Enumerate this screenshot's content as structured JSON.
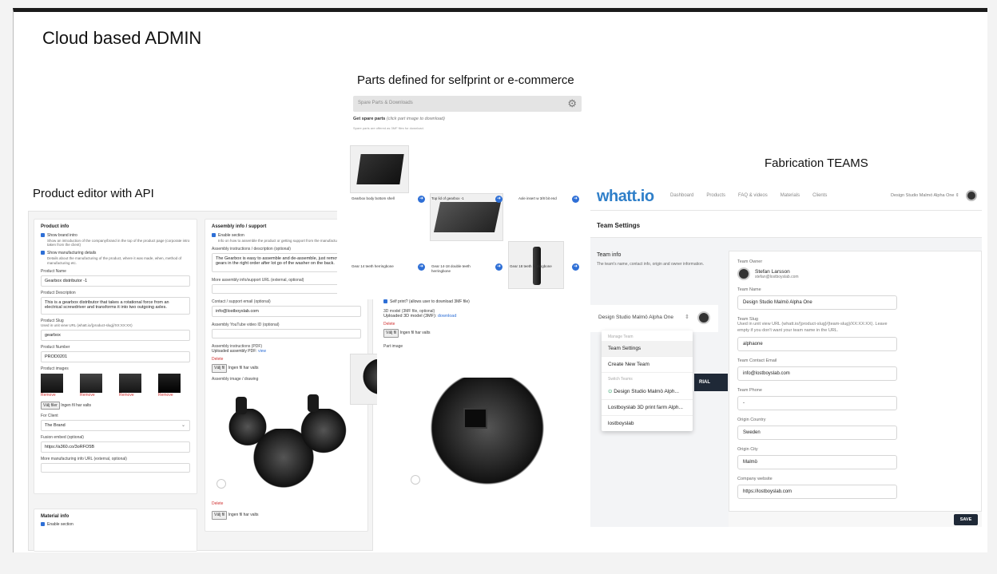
{
  "headings": {
    "cloud": "Cloud based ADMIN",
    "parts": "Parts defined for selfprint or e-commerce",
    "teams": "Fabrication TEAMS",
    "product": "Product editor with API"
  },
  "product_editor": {
    "section_title": "Product info",
    "show_brand": "Show brand intro",
    "show_brand_desc": "Show an introduction of the company/brand in the top of the product page (corporate intro taken from the client)",
    "show_mfg": "Show manufacturing details",
    "show_mfg_desc": "Details about the manufacturing of the product, where it was made, when, method of manufacturing etc.",
    "name_label": "Product Name",
    "name_value": "Gearbox distributor -1",
    "desc_label": "Product Description",
    "desc_value": "This is a gearbox distributor that takes a rotational force from an electrical screwdriver and transforms it into two outgoing axles.",
    "slug_label": "Product Slug",
    "slug_hint": "Used in unit view URL (whatt.io/{product-slug}/XX:XX:XX)",
    "slug_value": "gearbox",
    "number_label": "Product Number",
    "number_value": "PROD0201",
    "images_label": "Product images",
    "remove": "Remove",
    "choose_files": "Välj filer",
    "no_file": "Ingen fil har valts",
    "client_label": "For Client",
    "client_value": "The Brand",
    "fusion_label": "Fusion embed (optional)",
    "fusion_value": "https://a360.co/3oRFO5B",
    "more_url_label": "More manufacturing info URL (external, optional)",
    "material_title": "Material info",
    "enable_section": "Enable section"
  },
  "assembly": {
    "title": "Assembly info / support",
    "enable": "Enable section",
    "enable_desc": "Info on how to assemble the product or getting support from the manufacturer",
    "instr_label": "Assembly instructions / description (optional)",
    "instr_value": "The Gearbox is easy to assemble and de-assemble, just remove the gears in the right order after lot go of the washer on the back.",
    "url_label": "More assembly info/support URL (external, optional)",
    "email_label": "Contact / support email (optional)",
    "email_value": "info@lostboyslab.com",
    "yt_label": "Assembly YouTube video ID (optional)",
    "pdf_label": "Assembly instructions (PDF)",
    "pdf_uploaded": "Uploaded assembly PDF:",
    "view": "view",
    "delete": "Delete",
    "choose_file": "Välj fil",
    "no_file": "Ingen fil har valts",
    "image_label": "Assembly image / drawing"
  },
  "parts": {
    "search_placeholder": "Spare Parts & Downloads",
    "get_label": "Get spare parts",
    "get_hint": "(click part image to download)",
    "sub_hint": "Spare parts are offered as 3MF files for download.",
    "items": [
      {
        "name": "Gearbox body bottom shell"
      },
      {
        "name": "Top lid of gearbox -1"
      },
      {
        "name": "Axle insert w 3/8 bit end"
      },
      {
        "name": "Gear 14 teeth herringbone"
      },
      {
        "name": "Gear 14-18 double teeth herringbone"
      },
      {
        "name": "Gear 18 teeth herringbone"
      }
    ]
  },
  "selfprint": {
    "checkbox": "Self print? (allows user to download 3MF file)",
    "model_label": "3D model (3MF file, optional)",
    "uploaded": "Uploaded 3D model (3MF):",
    "download": "download",
    "delete": "Delete",
    "choose_file": "Välj fil",
    "no_file": "Ingen fil har valts",
    "part_image": "Part image"
  },
  "teams": {
    "logo": "whatt.io",
    "nav": [
      "Dashboard",
      "Products",
      "FAQ & videos",
      "Materials",
      "Clients"
    ],
    "team_switch": "Design Studio Malmö Alpha One",
    "page_title": "Team Settings",
    "info_title": "Team info",
    "info_desc": "The team's name, contact info, origin and owner information.",
    "selector_value": "Design Studio Malmö Alpha One",
    "dropdown": {
      "manage_header": "Manage Team",
      "team_settings": "Team Settings",
      "create_new": "Create New Team",
      "switch_header": "Switch Teams",
      "teams": [
        "Design Studio Malmö Alph...",
        "Lostboyslab 3D print farm Alph...",
        "lostboyslab"
      ]
    },
    "tutorial_btn": "RIAL",
    "owner_label": "Team Owner",
    "owner_name": "Stefan Larsson",
    "owner_email": "stefan@lostboyslab.com",
    "name_label": "Team Name",
    "name_value": "Design Studio Malmö Alpha One",
    "slug_label": "Team Slug",
    "slug_hint": "Used in unit view URL (whatt.io/{product-slug}/{team-slug}/XX:XX:XX). Leave empty if you don't want your team name in the URL.",
    "slug_value": "alphaone",
    "email_label": "Team Contact Email",
    "email_value": "info@lostboyslab.com",
    "phone_label": "Team Phone",
    "phone_value": "-",
    "country_label": "Origin Country",
    "country_value": "Sweden",
    "city_label": "Origin City",
    "city_value": "Malmö",
    "website_label": "Company website",
    "website_value": "https://lostboyslab.com",
    "save": "SAVE"
  }
}
